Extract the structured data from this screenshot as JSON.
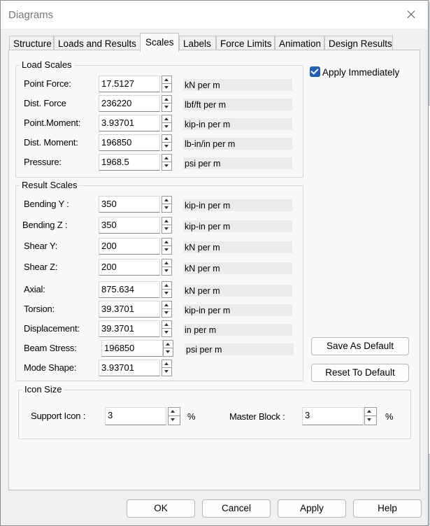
{
  "window": {
    "title": "Diagrams"
  },
  "tabs": [
    {
      "label": "Structure",
      "active": false
    },
    {
      "label": "Loads and Results",
      "active": false
    },
    {
      "label": "Scales",
      "active": true
    },
    {
      "label": "Labels",
      "active": false
    },
    {
      "label": "Force Limits",
      "active": false
    },
    {
      "label": "Animation",
      "active": false
    },
    {
      "label": "Design Results",
      "active": false
    }
  ],
  "load_scales": {
    "title": "Load Scales",
    "rows": [
      {
        "label": "Point Force:",
        "value": "17.5127",
        "unit": "kN per m"
      },
      {
        "label": "Dist. Force",
        "value": "236220",
        "unit": "lbf/ft per m"
      },
      {
        "label": "Point.Moment:",
        "value": "3.93701",
        "unit": "kip-in per m"
      },
      {
        "label": "Dist. Moment:",
        "value": "196850",
        "unit": "lb-in/in per m"
      },
      {
        "label": "Pressure:",
        "value": "1968.5",
        "unit": "psi per m"
      }
    ]
  },
  "result_scales": {
    "title": "Result Scales",
    "rows": [
      {
        "label": "Bending Y :",
        "value": "350",
        "unit": "kip-in per m"
      },
      {
        "label": "Bending Z :",
        "value": "350",
        "unit": "kip-in per m"
      },
      {
        "label": "Shear Y:",
        "value": "200",
        "unit": "kN per m"
      },
      {
        "label": "Shear Z:",
        "value": "200",
        "unit": "kN per m"
      },
      {
        "label": "Axial:",
        "value": "875.634",
        "unit": "kN per m"
      },
      {
        "label": "Torsion:",
        "value": "39.3701",
        "unit": "kip-in per m"
      },
      {
        "label": "Displacement:",
        "value": "39.3701",
        "unit": "in per m"
      },
      {
        "label": "Beam Stress:",
        "value": "196850",
        "unit": "psi per m"
      },
      {
        "label": "Mode Shape:",
        "value": "3.93701",
        "unit": ""
      }
    ]
  },
  "apply_immediately": {
    "label": "Apply Immediately",
    "checked": true
  },
  "side_buttons": {
    "save_default": "Save As Default",
    "reset_default": "Reset To Default"
  },
  "icon_size": {
    "title": "Icon Size",
    "support_label": "Support Icon :",
    "support_value": "3",
    "master_label": "Master Block :",
    "master_value": "3",
    "percent": "%"
  },
  "footer": {
    "ok": "OK",
    "cancel": "Cancel",
    "apply": "Apply",
    "help": "Help"
  },
  "colors": {
    "accent": "#1f5fb0"
  }
}
